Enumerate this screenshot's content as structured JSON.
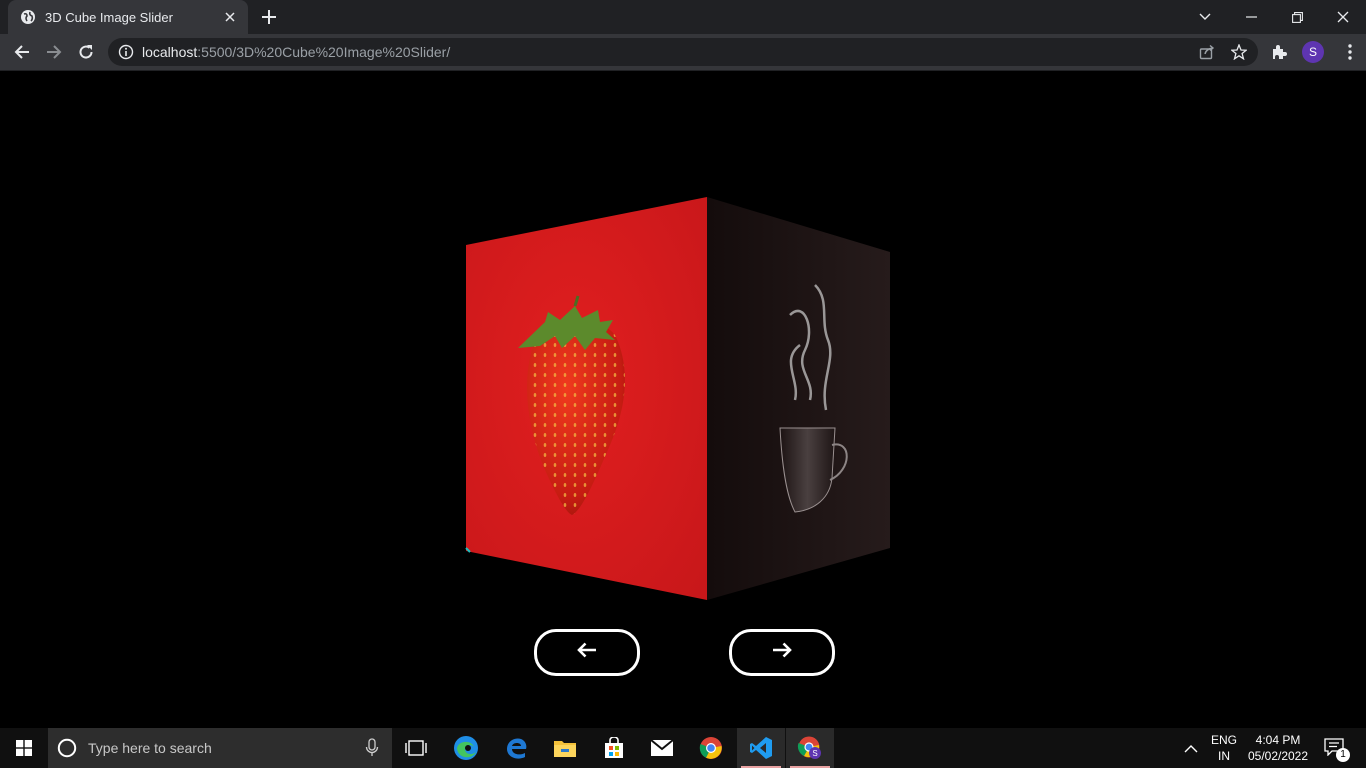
{
  "browser": {
    "tab_title": "3D Cube Image Slider",
    "url_host": "localhost",
    "url_rest": ":5500/3D%20Cube%20Image%20Slider/",
    "profile_initial": "S"
  },
  "slider": {
    "front_face": "strawberry on red background",
    "right_face": "steaming coffee cup on dark background",
    "prev_button": "arrow-left-icon",
    "next_button": "arrow-right-icon"
  },
  "taskbar": {
    "search_placeholder": "Type here to search",
    "lang_top": "ENG",
    "lang_bottom": "IN",
    "time": "4:04 PM",
    "date": "05/02/2022",
    "notification_count": "1"
  },
  "colors": {
    "page_background": "#000000",
    "front_face": "#d81c1c",
    "right_face": "#1d1313",
    "button_border": "#ffffff"
  }
}
